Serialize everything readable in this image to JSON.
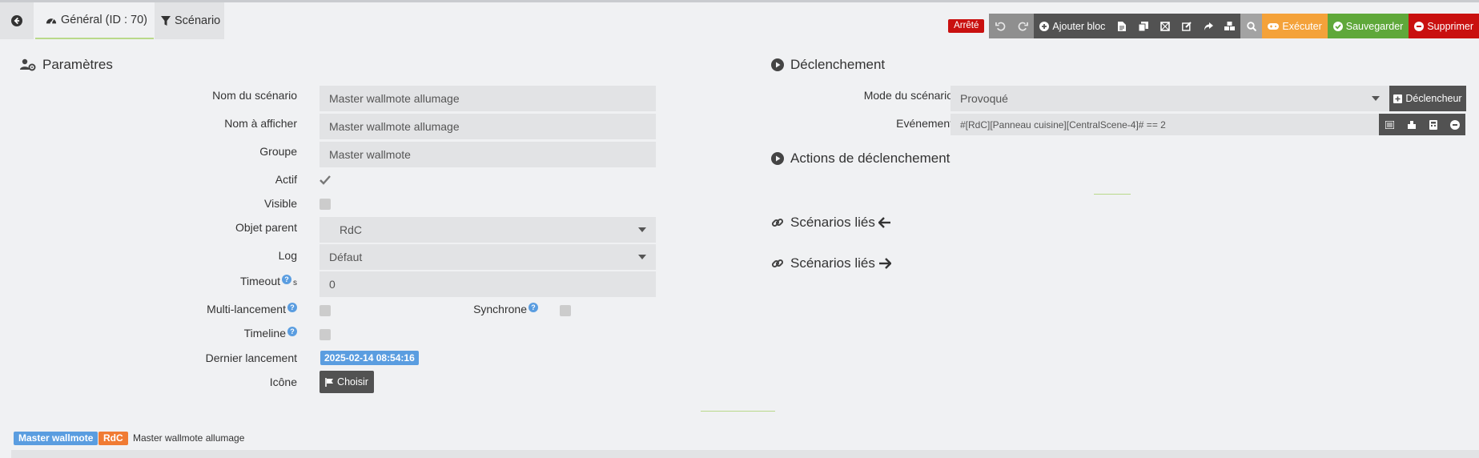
{
  "tabs": {
    "general": "Général (ID : 70)",
    "scenario": "Scénario"
  },
  "toolbar": {
    "state": "Arrêté",
    "add_block": "Ajouter bloc",
    "execute": "Exécuter",
    "save": "Sauvegarder",
    "delete": "Supprimer"
  },
  "params": {
    "heading": "Paramètres",
    "name_label": "Nom du scénario",
    "name_value": "Master wallmote allumage",
    "display_label": "Nom à afficher",
    "display_value": "Master wallmote allumage",
    "group_label": "Groupe",
    "group_value": "Master wallmote",
    "active_label": "Actif",
    "visible_label": "Visible",
    "parent_label": "Objet parent",
    "parent_value": "RdC",
    "log_label": "Log",
    "log_value": "Défaut",
    "timeout_label": "Timeout",
    "timeout_unit": "s",
    "timeout_value": "0",
    "multi_label": "Multi-lancement",
    "sync_label": "Synchrone",
    "timeline_label": "Timeline",
    "last_run_label": "Dernier lancement",
    "last_run_value": "2025-02-14 08:54:16",
    "icon_label": "Icône",
    "choose_label": "Choisir"
  },
  "trigger": {
    "heading": "Déclenchement",
    "mode_label": "Mode du scénario",
    "mode_value": "Provoqué",
    "trigger_button": "Déclencheur",
    "event_label": "Evénement",
    "event_value": "#[RdC][Panneau cuisine][CentralScene-4]# == 2",
    "actions_heading": "Actions de déclenchement",
    "linked_in": "Scénarios liés",
    "linked_out": "Scénarios liés"
  },
  "footer": {
    "tag_group": "Master wallmote",
    "tag_parent": "RdC",
    "name": "Master wallmote allumage"
  },
  "colors": {
    "accent_green": "#5fa83a",
    "accent_orange": "#f4a23a",
    "danger": "#c9100f",
    "info": "#5a9de0"
  }
}
